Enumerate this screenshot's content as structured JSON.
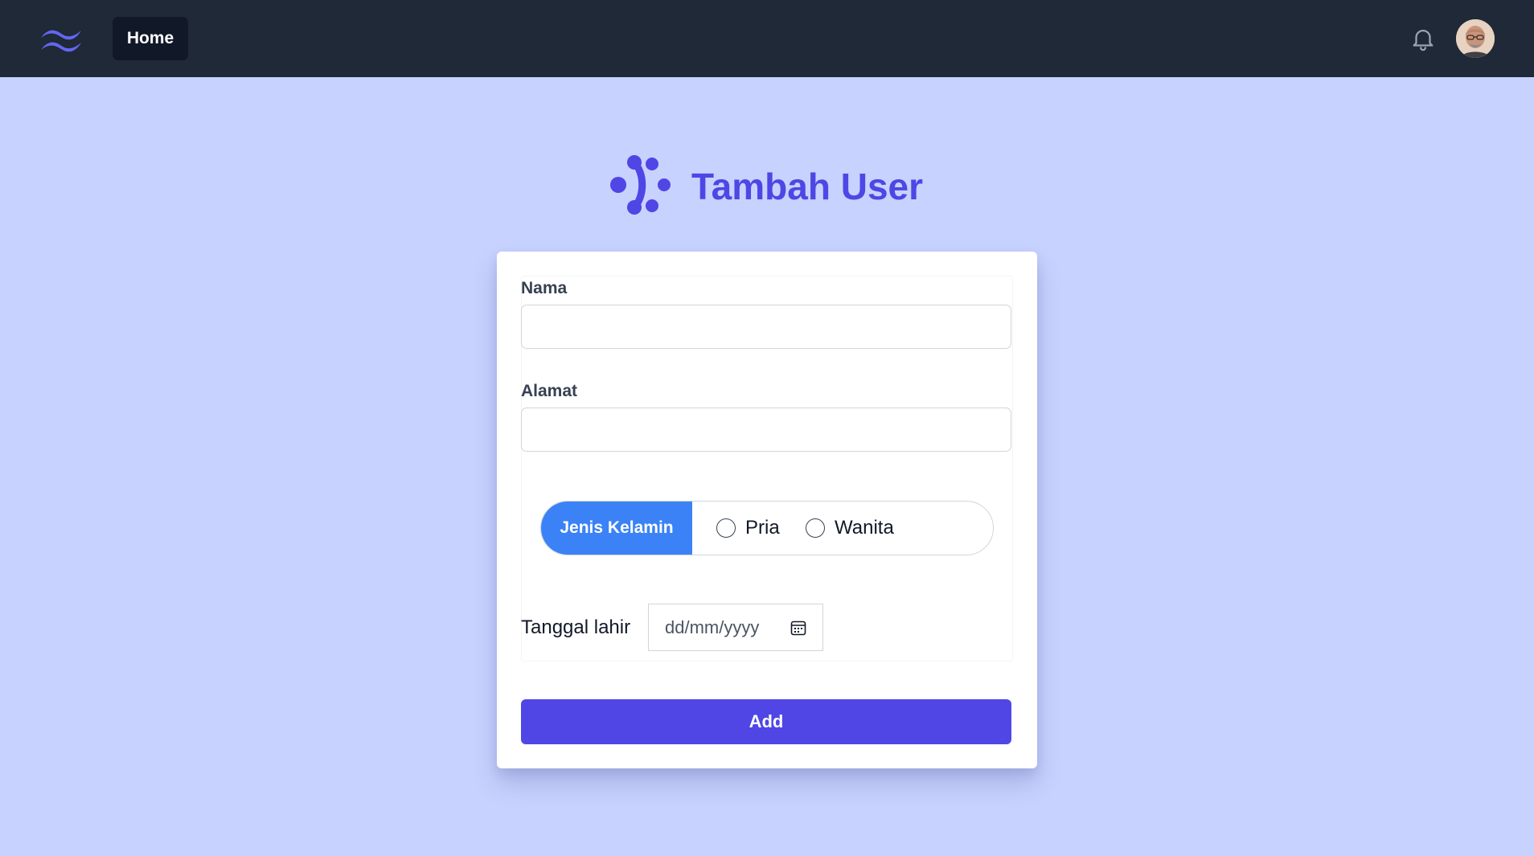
{
  "navbar": {
    "logo_icon": "tailwind-wave-logo",
    "home_label": "Home",
    "bell_icon": "bell-icon",
    "avatar_icon": "user-avatar"
  },
  "header": {
    "logo_icon": "dots-network-logo",
    "title": "Tambah User"
  },
  "form": {
    "nama_label": "Nama",
    "nama_value": "",
    "alamat_label": "Alamat",
    "alamat_value": "",
    "gender": {
      "label": "Jenis Kelamin",
      "options": [
        "Pria",
        "Wanita"
      ]
    },
    "tanggal_label": "Tanggal lahir",
    "tanggal_placeholder": "dd/mm/yyyy",
    "submit_label": "Add"
  },
  "colors": {
    "navbar_bg": "#1f2937",
    "page_bg": "#c7d2fe",
    "accent": "#4f46e5",
    "gender_label_bg": "#3b82f6"
  }
}
